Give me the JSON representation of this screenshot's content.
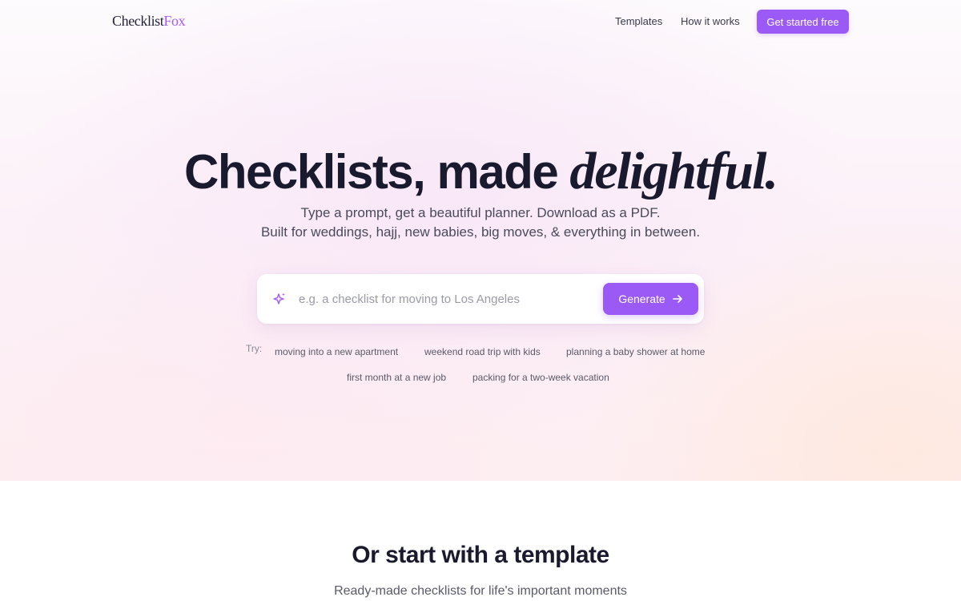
{
  "header": {
    "logo_part1": "Checklist",
    "logo_part2": "Fox",
    "nav": [
      {
        "label": "Templates"
      },
      {
        "label": "How it works"
      }
    ],
    "cta_label": "Get started free"
  },
  "hero": {
    "headline_main": "Checklists, made ",
    "headline_accent": "delightful.",
    "subtitle_line1": "Type a prompt, get a beautiful planner. Download as a PDF.",
    "subtitle_line2": "Built for weddings, hajj, new babies, big moves, & everything in between."
  },
  "search": {
    "icon": "sparkle-icon",
    "placeholder": "e.g. a checklist for moving to Los Angeles",
    "value": "",
    "button_label": "Generate",
    "button_icon": "arrow-right-icon"
  },
  "suggestions": {
    "label": "Try:",
    "items": [
      "moving into a new apartment",
      "weekend road trip with kids",
      "planning a baby shower at home",
      "first month at a new job",
      "packing for a two-week vacation"
    ]
  },
  "templates_section": {
    "title": "Or start with a template",
    "subtitle": "Ready-made checklists for life's important moments"
  },
  "colors": {
    "accent": "#9b5af5",
    "logo_accent": "#a35bf3",
    "heading": "#1a1a2e",
    "body_text": "#4a4a5a"
  }
}
